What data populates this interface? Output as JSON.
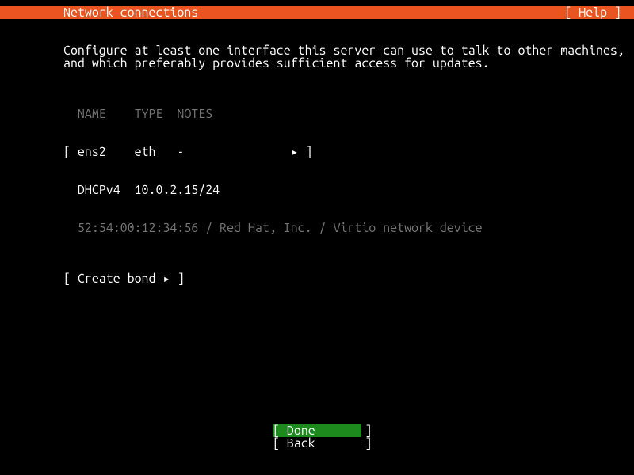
{
  "header": {
    "title": "Network connections",
    "help": "[ Help ]"
  },
  "instruction_line1": "Configure at least one interface this server can use to talk to other machines,",
  "instruction_line2": "and which preferably provides sufficient access for updates.",
  "table": {
    "header": "  NAME    TYPE  NOTES",
    "iface_row": {
      "lbracket": "[ ",
      "name": "ens2    ",
      "type": "eth   ",
      "notes": "-               ",
      "arrow": "▸",
      "rbracket": " ]"
    },
    "addr_row": "  DHCPv4  10.0.2.15/24",
    "info_row": "  52:54:00:12:34:56 / Red Hat, Inc. / Virtio network device"
  },
  "create_bond": {
    "lbracket": "[ ",
    "label": "Create bond ",
    "arrow": "▸",
    "rbracket": " ]"
  },
  "nav": {
    "done": "[ Done       ]",
    "back": "[ Back       ]"
  }
}
